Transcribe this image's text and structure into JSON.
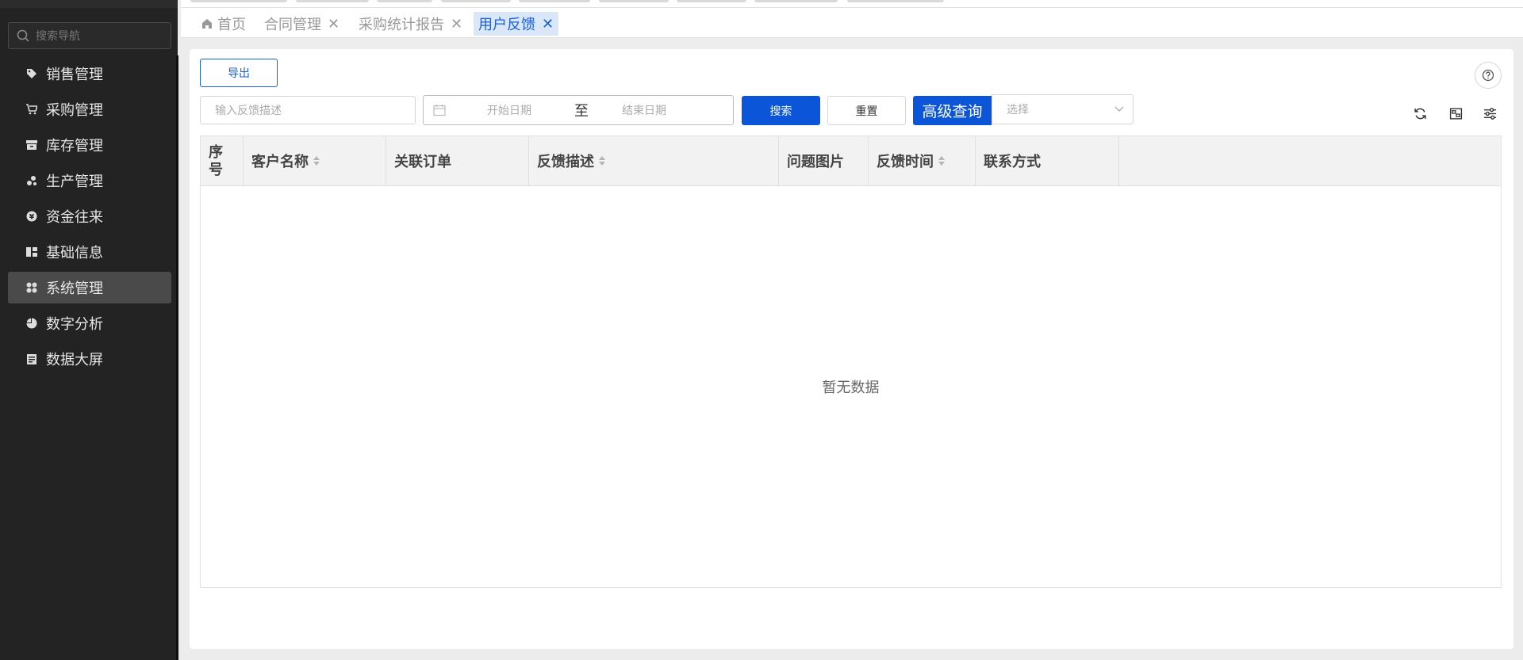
{
  "sidebar": {
    "search_placeholder": "搜索导航",
    "items": [
      {
        "label": "销售管理",
        "icon": "tag-icon"
      },
      {
        "label": "采购管理",
        "icon": "cart-icon"
      },
      {
        "label": "库存管理",
        "icon": "archive-box-icon"
      },
      {
        "label": "生产管理",
        "icon": "nodes-icon"
      },
      {
        "label": "资金往来",
        "icon": "coin-icon"
      },
      {
        "label": "基础信息",
        "icon": "blocks-icon"
      },
      {
        "label": "系统管理",
        "icon": "grid-dots-icon",
        "active": true
      },
      {
        "label": "数字分析",
        "icon": "pie-icon"
      },
      {
        "label": "数据大屏",
        "icon": "clipboard-icon"
      }
    ]
  },
  "tabs": [
    {
      "label": "首页",
      "icon": "home-icon"
    },
    {
      "label": "合同管理",
      "closable": true
    },
    {
      "label": "采购统计报告",
      "closable": true
    },
    {
      "label": "用户反馈",
      "closable": true,
      "active": true
    }
  ],
  "toolbar": {
    "export_label": "导出",
    "help_icon": "question-icon"
  },
  "filters": {
    "keyword_placeholder": "输入反馈描述",
    "date_start_placeholder": "开始日期",
    "date_separator": "至",
    "date_end_placeholder": "结束日期",
    "search_label": "搜索",
    "reset_label": "重置",
    "advanced_label": "高级查询",
    "advanced_select_placeholder": "选择"
  },
  "table": {
    "columns": [
      {
        "label": "序号",
        "sortable": false
      },
      {
        "label": "客户名称",
        "sortable": true
      },
      {
        "label": "关联订单",
        "sortable": false
      },
      {
        "label": "反馈描述",
        "sortable": true
      },
      {
        "label": "问题图片",
        "sortable": false
      },
      {
        "label": "反馈时间",
        "sortable": true
      },
      {
        "label": "联系方式",
        "sortable": false
      }
    ],
    "rows": [],
    "empty_text": "暂无数据"
  },
  "colors": {
    "primary": "#0a55d8",
    "sidebar_bg": "#232323",
    "tab_active_bg": "#d9e7f9"
  }
}
